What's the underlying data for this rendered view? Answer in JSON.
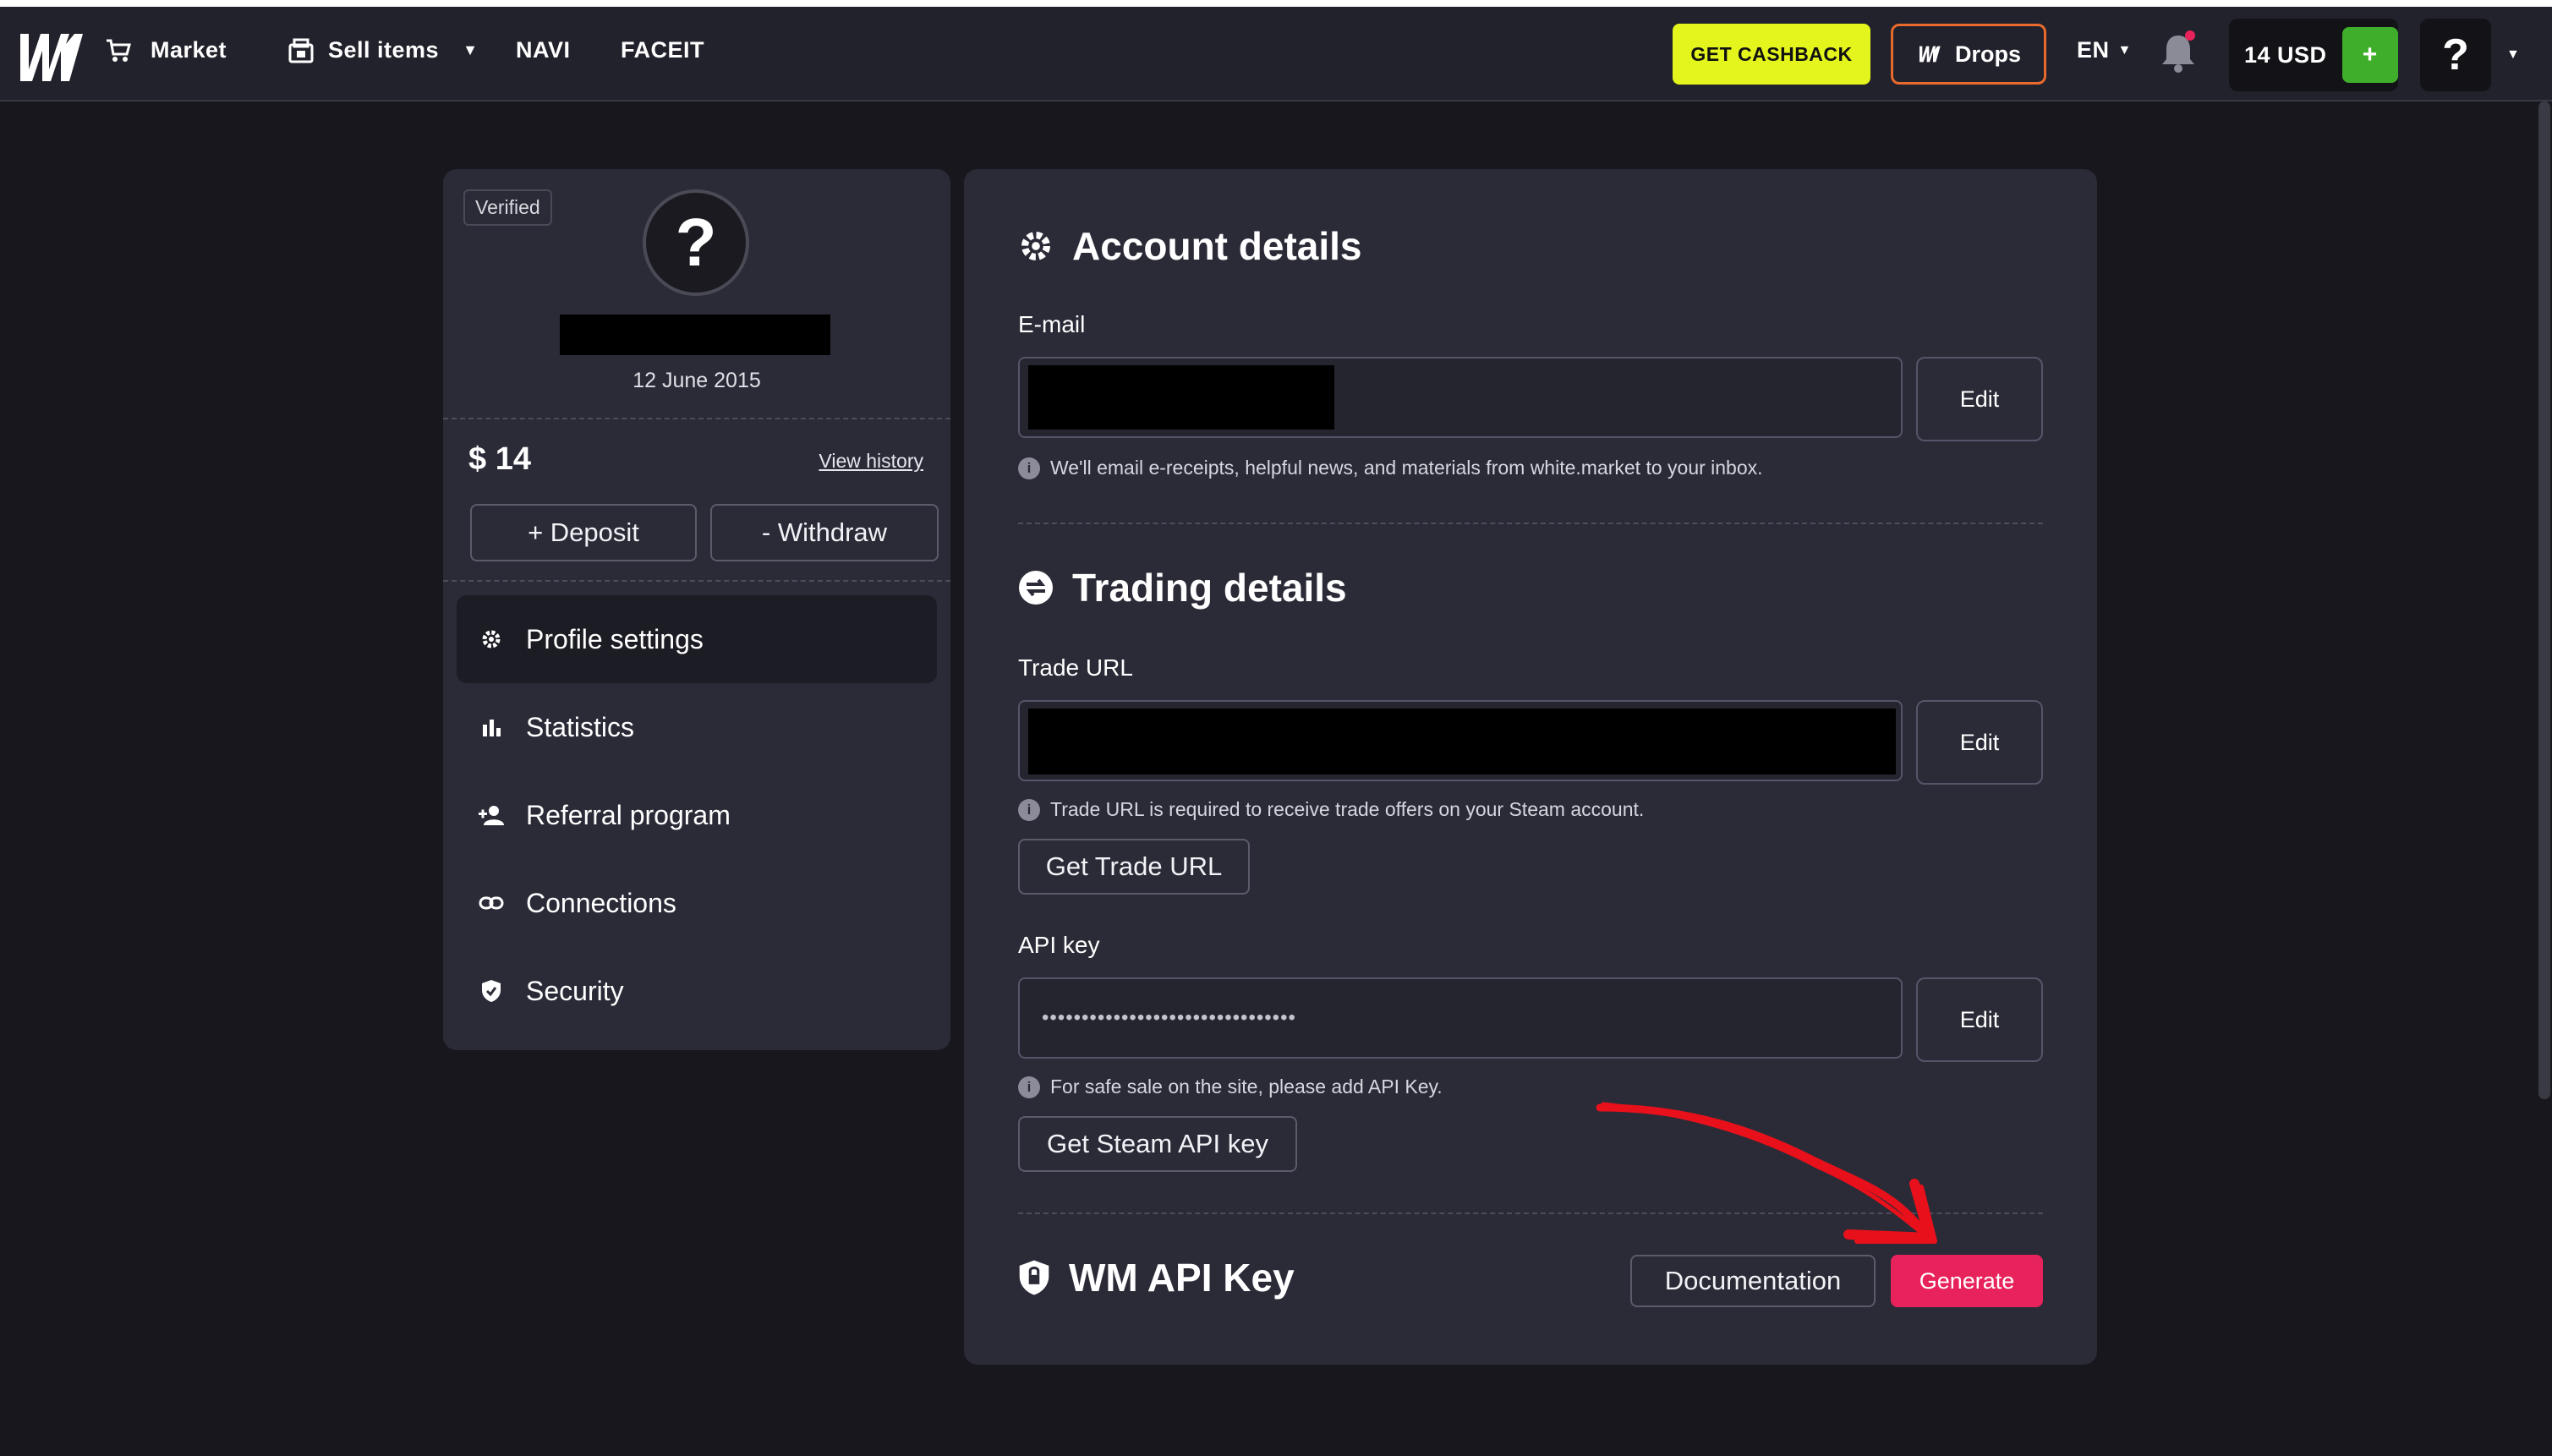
{
  "navbar": {
    "market_label": "Market",
    "sell_label": "Sell items",
    "navi_label": "NAVI",
    "faceit_label": "FACEIT",
    "cashback_label": "GET CASHBACK",
    "drops_label": "Drops",
    "language": "EN",
    "balance_label": "14 USD",
    "add_funds_label": "+",
    "help_label": "?"
  },
  "profile": {
    "verified_label": "Verified",
    "avatar_label": "?",
    "join_date": "12 June 2015",
    "balance": "$ 14",
    "view_history_label": "View history",
    "deposit_label": "+ Deposit",
    "withdraw_label": "- Withdraw"
  },
  "sidebar": {
    "items": [
      {
        "label": "Profile settings",
        "icon": "gear-icon",
        "active": true
      },
      {
        "label": "Statistics",
        "icon": "bar-chart-icon"
      },
      {
        "label": "Referral program",
        "icon": "add-user-icon"
      },
      {
        "label": "Connections",
        "icon": "link-icon"
      },
      {
        "label": "Security",
        "icon": "shield-icon"
      }
    ]
  },
  "account": {
    "title": "Account details",
    "email_label": "E-mail",
    "email_edit_label": "Edit",
    "email_hint": "We'll email e-receipts, helpful news, and materials from white.market to your inbox."
  },
  "trading": {
    "title": "Trading details",
    "trade_url_label": "Trade URL",
    "trade_url_edit_label": "Edit",
    "trade_url_hint": "Trade URL is required to receive trade offers on your Steam account.",
    "get_trade_url_label": "Get Trade URL",
    "api_key_label": "API key",
    "api_key_value": "••••••••••••••••••••••••••••••••",
    "api_key_edit_label": "Edit",
    "api_key_hint": "For safe sale on the site, please add API Key.",
    "get_api_key_label": "Get Steam API key"
  },
  "wm_api": {
    "title": "WM API Key",
    "documentation_label": "Documentation",
    "generate_label": "Generate"
  },
  "colors": {
    "background": "#17171d",
    "panel": "#2b2b38",
    "cashback_yellow": "#e3f51c",
    "drops_orange": "#e86a2c",
    "add_funds_green": "#3fae2a",
    "generate_pink": "#e8225a",
    "annotation_red": "#e8101a"
  }
}
